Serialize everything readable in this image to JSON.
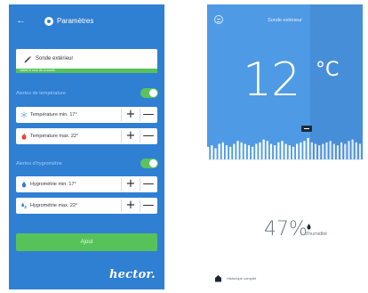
{
  "left_screen": {
    "back_icon": "back-arrow-icon",
    "title": "Paramètres",
    "title_icon": "gear-icon",
    "sensor_name": {
      "value": "Sonde extérieur",
      "icon": "pencil-icon",
      "hint": "Validé le nom de la sonde"
    },
    "temperature_section": {
      "label": "Alertes de température",
      "toggle_on": true,
      "rows": [
        {
          "label": "Température min. 17°",
          "icon": "snowflake-icon",
          "plus": "+",
          "minus": "—"
        },
        {
          "label": "Température max. 22°",
          "icon": "flame-icon",
          "plus": "+",
          "minus": "—"
        }
      ]
    },
    "humidity_section": {
      "label": "Alertes d'hygrométrie",
      "toggle_on": true,
      "rows": [
        {
          "label": "Hygrométrie min. 17°",
          "icon": "droplet-icon",
          "plus": "+",
          "minus": "—"
        },
        {
          "label": "Hygrométrie max. 22°",
          "icon": "droplets-icon",
          "plus": "+",
          "minus": "—"
        }
      ]
    },
    "save_label": "Ajout",
    "brand": "hector."
  },
  "right_screen": {
    "menu_icon": "menu-icon",
    "title": "Sonde extérieur",
    "temperature": "12",
    "temperature_unit": "°C",
    "temperature_history": [
      10,
      11,
      9,
      12,
      13,
      11,
      10,
      12,
      14,
      13,
      12,
      11,
      10,
      12,
      13,
      15,
      14,
      12,
      11,
      13,
      14,
      12,
      11,
      10,
      12,
      13,
      14,
      16,
      13,
      12,
      11,
      12,
      13,
      14,
      12,
      11,
      13,
      12,
      14,
      15,
      13,
      12
    ],
    "humidity": "47%",
    "humidity_label": "d'humidité",
    "humidity_icon": "droplet-icon",
    "footer_icon": "home-icon",
    "footer_label": "Historique complet"
  },
  "colors": {
    "left_bg": "#2f7fd3",
    "right_bg": "#4f9ae4",
    "accent_green": "#58c25a"
  }
}
